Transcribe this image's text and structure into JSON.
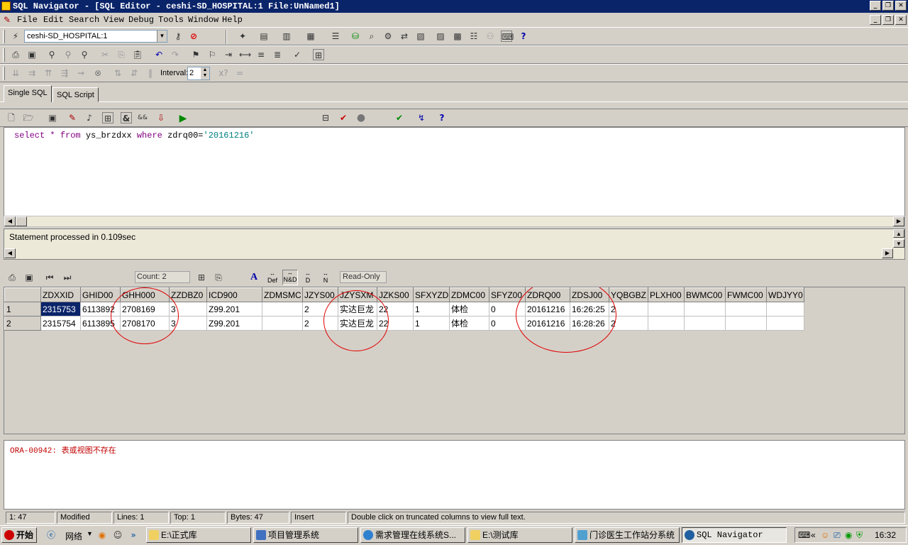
{
  "window": {
    "title": "SQL Navigator - [SQL Editor - ceshi-SD_HOSPITAL:1 File:UnNamed1]"
  },
  "menu": [
    "File",
    "Edit",
    "Search",
    "View",
    "Debug",
    "Tools",
    "Window",
    "Help"
  ],
  "connection": {
    "value": "ceshi-SD_HOSPITAL:1"
  },
  "interval": {
    "label": "Interval:",
    "value": "2"
  },
  "tabs": [
    "Single SQL",
    "SQL Script"
  ],
  "editor": {
    "select": "select",
    "star": "*",
    "from": "from",
    "table": "ys_brzdxx",
    "where": "where",
    "col": "zdrq00=",
    "literal": "'20161216'"
  },
  "message": "Statement processed in 0.109sec",
  "grid_toolbar": {
    "count": "Count: 2",
    "readonly": "Read-Only",
    "def": "Def",
    "nd": "N&D",
    "d": "D",
    "n": "N"
  },
  "grid": {
    "columns": [
      "ZDXXID",
      "GHID00",
      "GHH000",
      "ZZDBZ0",
      "ICD900",
      "ZDMSMC",
      "JZYS00",
      "JZYSXM",
      "JZKS00",
      "SFXYZD",
      "ZDMC00",
      "SFYZ00",
      "ZDRQ00",
      "ZDSJ00",
      "YQBGBZ",
      "PLXH00",
      "BWMC00",
      "FWMC00",
      "WDJYY0"
    ],
    "rows": [
      [
        "1",
        "2315753",
        "6113892",
        "2708169",
        "3",
        "Z99.201",
        "",
        "2",
        "实达巨龙",
        "22",
        "1",
        "体检",
        "0",
        "20161216",
        "16:26:25",
        "2",
        "",
        "",
        "",
        ""
      ],
      [
        "2",
        "2315754",
        "6113895",
        "2708170",
        "3",
        "Z99.201",
        "",
        "2",
        "实达巨龙",
        "22",
        "1",
        "体检",
        "0",
        "20161216",
        "16:28:26",
        "2",
        "",
        "",
        "",
        ""
      ]
    ]
  },
  "error": "ORA-00942: 表或视图不存在",
  "status": {
    "pos": "1: 47",
    "modified": "Modified",
    "lines": "Lines: 1",
    "top": "Top: 1",
    "bytes": "Bytes: 47",
    "mode": "Insert",
    "hint": "Double click on truncated columns to view full text."
  },
  "taskbar": {
    "start": "开始",
    "network": "网络",
    "items": [
      "E:\\正式库",
      "项目管理系统",
      "需求管理在线系统S...",
      "E:\\测试库",
      "门诊医生工作站分系统",
      "SQL Navigator"
    ],
    "clock": "16:32"
  }
}
